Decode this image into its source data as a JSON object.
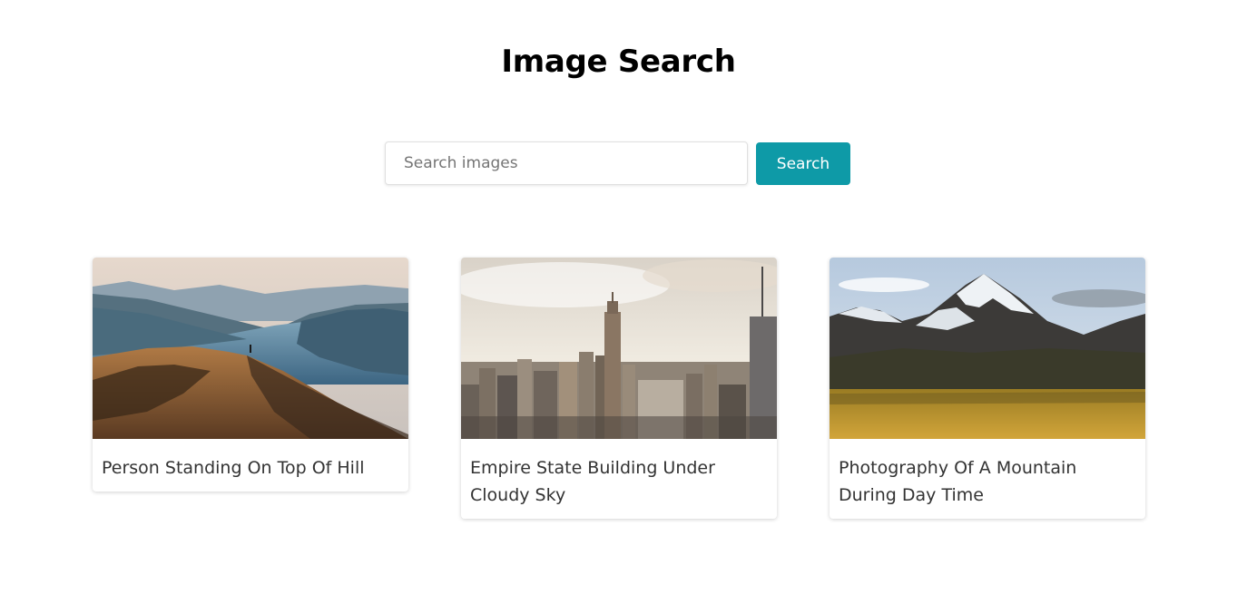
{
  "header": {
    "title": "Image Search"
  },
  "search": {
    "placeholder": "Search images",
    "value": "",
    "button_label": "Search"
  },
  "colors": {
    "accent": "#0e9aa7",
    "text": "#333333",
    "title": "#000000"
  },
  "results": [
    {
      "title": "Person Standing On Top Of Hill"
    },
    {
      "title": "Empire State Building Under Cloudy Sky"
    },
    {
      "title": "Photography Of A Mountain During Day Time"
    }
  ]
}
